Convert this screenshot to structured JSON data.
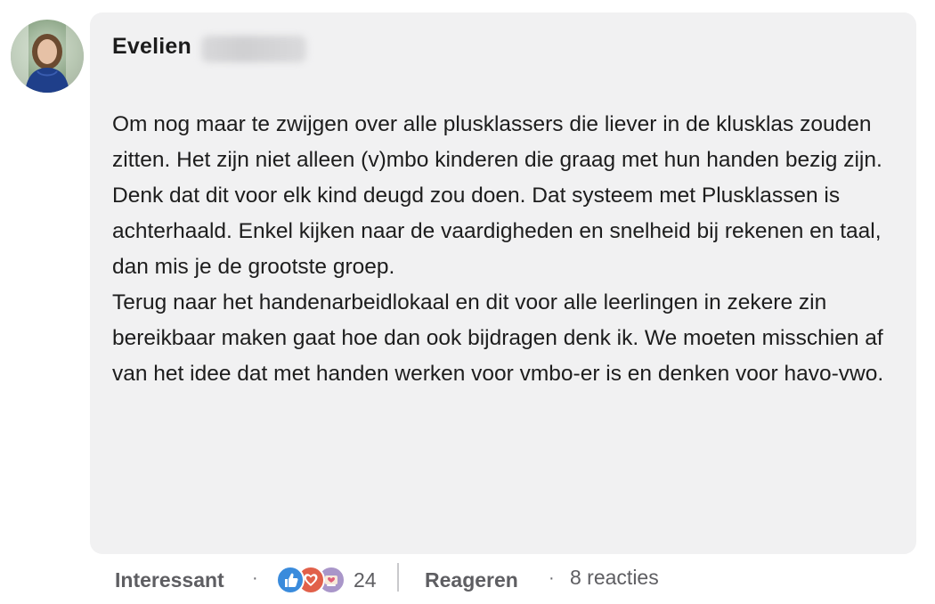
{
  "comment": {
    "author_first_name": "Evelien",
    "paragraphs": [
      "Om nog maar te zwijgen over alle plusklassers die liever in de klusklas zouden zitten. Het zijn niet alleen (v)mbo kinderen die graag met hun handen bezig zijn. Denk dat dit voor elk kind deugd zou doen. Dat systeem met Plusklassen is achterhaald. Enkel kijken naar de vaardigheden en snelheid bij rekenen en taal, dan mis je de grootste groep.",
      "Terug naar het handenarbeidlokaal en dit voor alle leerlingen in zekere zin bereikbaar maken gaat hoe dan ook bijdragen denk ik. We moeten misschien af van het idee dat met handen werken voor vmbo-er is en denken voor havo-vwo."
    ]
  },
  "actions": {
    "like_label": "Interessant",
    "separator": "·",
    "reaction_icons": [
      "like-icon",
      "love-icon",
      "insightful-icon"
    ],
    "reaction_count": "24",
    "reply_label": "Reageren",
    "replies_label": "8 reacties"
  },
  "colors": {
    "bubble_bg": "#f1f1f2",
    "text": "#1d1d1d",
    "muted": "#5e5e62",
    "like": "#3a8bdc",
    "love": "#e1604a",
    "insightful": "#a996c9"
  }
}
